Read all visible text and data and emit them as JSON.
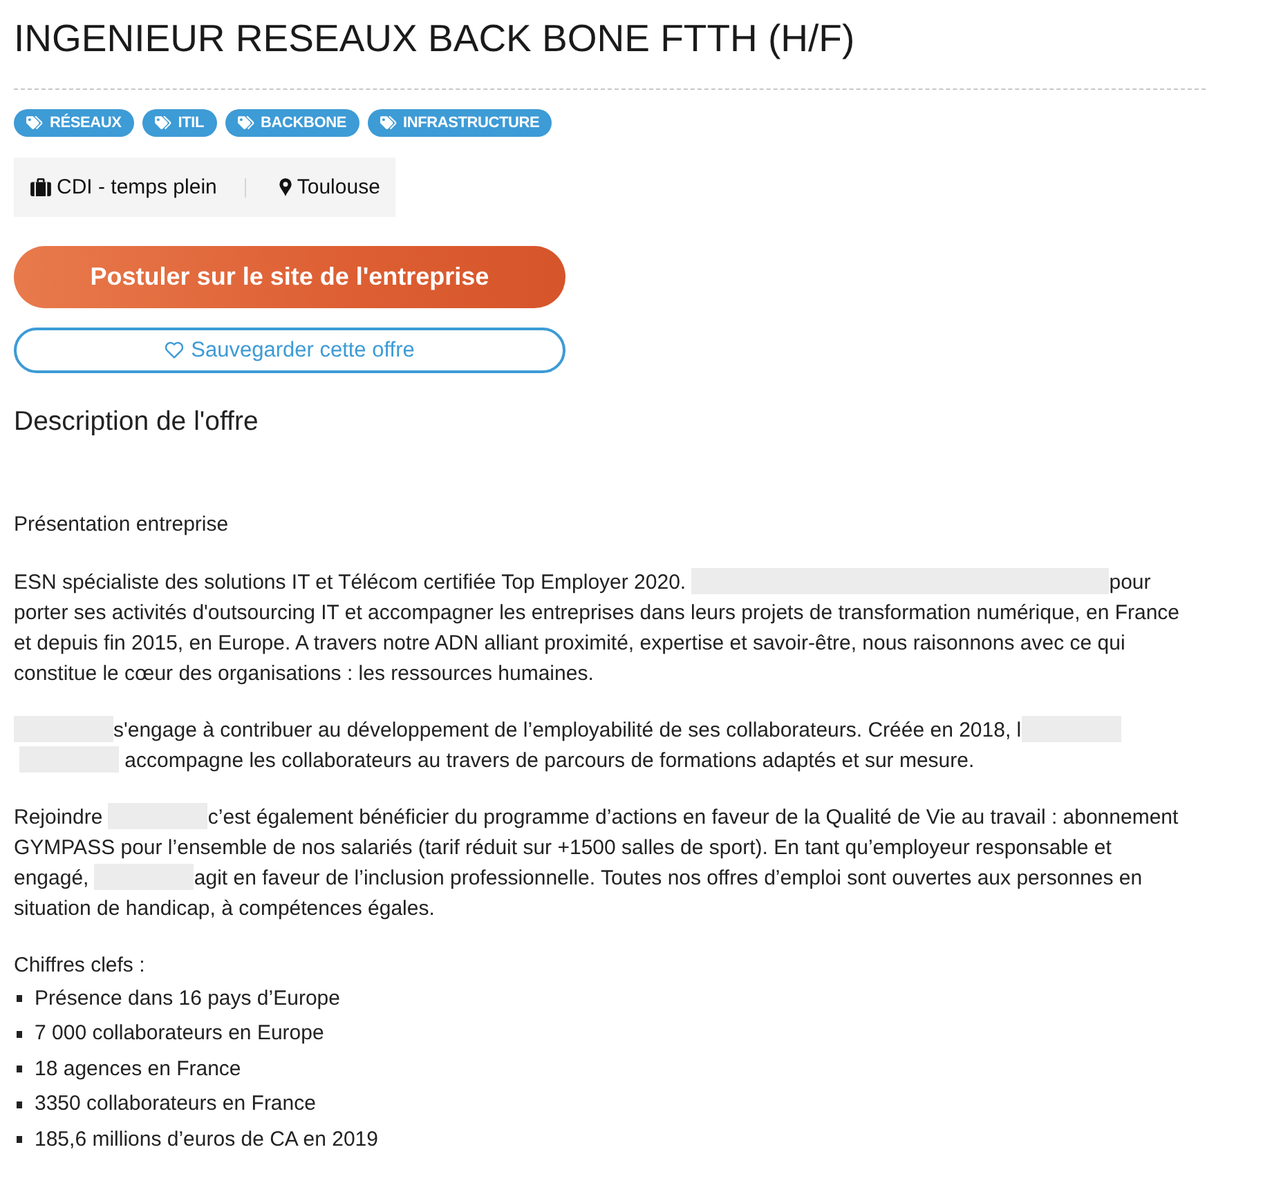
{
  "title": "INGENIEUR RESEAUX BACK BONE FTTH (H/F)",
  "tags": [
    {
      "label": "RÉSEAUX"
    },
    {
      "label": "ITIL"
    },
    {
      "label": "BACKBONE"
    },
    {
      "label": "INFRASTRUCTURE"
    }
  ],
  "meta": [
    {
      "kind": "contract",
      "text": "CDI - temps plein"
    },
    {
      "kind": "location",
      "text": "Toulouse"
    }
  ],
  "apply_button": "Postuler sur le site de l'entreprise",
  "save_button": "Sauvegarder cette offre",
  "description": {
    "heading": "Description de l'offre",
    "blocks": [
      {
        "kind": "text",
        "text": "Présentation entreprise"
      },
      {
        "kind": "paragraph",
        "segments": [
          {
            "kind": "text",
            "text": "ESN spécialiste des solutions IT et Télécom certifiée Top Employer 2020. "
          },
          {
            "kind": "redacted",
            "wide": true
          },
          {
            "kind": "text",
            "text": "pour porter ses activités d'outsourcing IT et accompagner les entreprises dans leurs projets de transformation numérique, en France et depuis fin 2015, en Europe. A travers notre ADN alliant proximité, expertise et savoir-être, nous raisonnons avec ce qui constitue le cœur des organisations : les ressources humaines."
          }
        ]
      },
      {
        "kind": "paragraph",
        "segments": [
          {
            "kind": "redacted",
            "wide": false
          },
          {
            "kind": "text",
            "text": "s'engage à contribuer au développement de l’employabilité de ses collaborateurs. Créée en 2018, l"
          },
          {
            "kind": "redacted",
            "wide": false
          },
          {
            "kind": "redacted",
            "wide": false
          },
          {
            "kind": "text",
            "text": " accompagne les collaborateurs au travers de parcours de formations adaptés et sur mesure."
          }
        ]
      },
      {
        "kind": "paragraph",
        "segments": [
          {
            "kind": "text",
            "text": "Rejoindre "
          },
          {
            "kind": "redacted",
            "wide": false
          },
          {
            "kind": "text",
            "text": "c’est également bénéficier du programme d’actions en faveur de la Qualité de Vie au travail : abonnement GYMPASS pour l’ensemble de nos salariés (tarif réduit sur +1500 salles de sport). En tant qu’employeur responsable et engagé, "
          },
          {
            "kind": "redacted",
            "wide": false
          },
          {
            "kind": "text",
            "text": "agit en faveur de l’inclusion professionnelle. Toutes nos offres d’emploi sont ouvertes aux personnes en situation de handicap, à compétences égales."
          }
        ]
      },
      {
        "kind": "list",
        "title": "Chiffres clefs :",
        "items": [
          "Présence dans 16 pays d’Europe",
          "7 000 collaborateurs en Europe",
          "18 agences en France",
          "3350 collaborateurs en France",
          "185,6 millions d’euros de CA en 2019"
        ]
      }
    ]
  }
}
